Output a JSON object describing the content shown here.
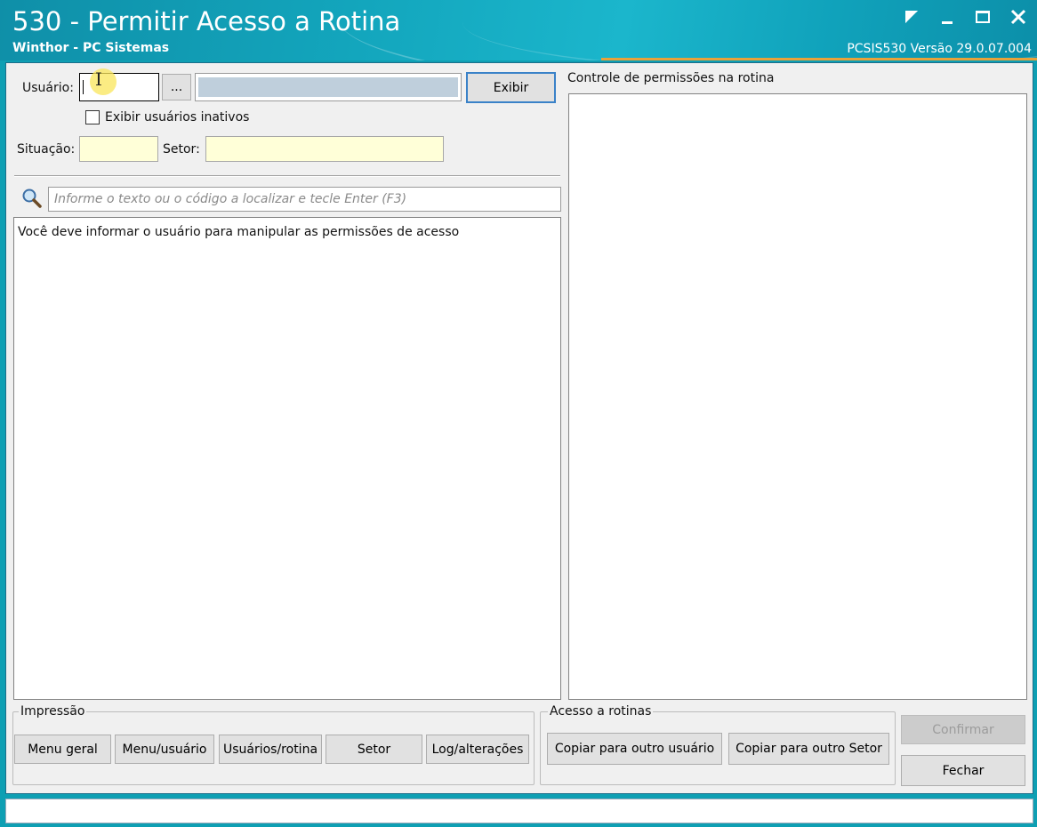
{
  "window": {
    "title": "530 - Permitir Acesso a Rotina",
    "subtitle": "Winthor - PC Sistemas",
    "version": "PCSIS530  Versão  29.0.07.004"
  },
  "form": {
    "usuario_label": "Usuário:",
    "usuario_value": "",
    "lookup_button": "...",
    "exibir_button": "Exibir",
    "inactive_checkbox_label": "Exibir usuários inativos",
    "inactive_checked": false,
    "situacao_label": "Situação:",
    "setor_label": "Setor:",
    "search_placeholder": "Informe o texto ou o código a localizar e tecle Enter (F3)",
    "list_message": "Você deve informar o usuário para manipular as permissões de acesso"
  },
  "right_panel": {
    "title": "Controle de permissões na rotina"
  },
  "impressao": {
    "title": "Impressão",
    "buttons": [
      "Menu geral",
      "Menu/usuário",
      "Usuários/rotina",
      "Setor",
      "Log/alterações"
    ]
  },
  "acesso": {
    "title": "Acesso a rotinas",
    "buttons": [
      "Copiar para outro usuário",
      "Copiar para outro Setor"
    ]
  },
  "actions": {
    "confirmar": "Confirmar",
    "fechar": "Fechar"
  },
  "icons": {
    "search": "magnifier-icon",
    "restore": "restore-icon",
    "minimize": "minimize-icon",
    "maximize": "maximize-icon",
    "close": "close-icon"
  }
}
